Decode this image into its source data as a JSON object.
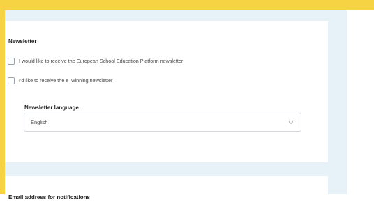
{
  "newsletter": {
    "title": "Newsletter",
    "options": [
      {
        "label": "I would like to receive the European School Education Platform newsletter",
        "checked": false
      },
      {
        "label": "I'd like to receive the eTwinning newsletter",
        "checked": false
      }
    ],
    "language_label": "Newsletter language",
    "language_value": "English"
  },
  "email": {
    "title": "Email address for notifications"
  },
  "colors": {
    "accent_band": "#f6d343",
    "panel_background": "#e6f2f8",
    "card_background": "#ffffff"
  },
  "icons": {
    "select_chevron": "chevron-down-icon"
  }
}
